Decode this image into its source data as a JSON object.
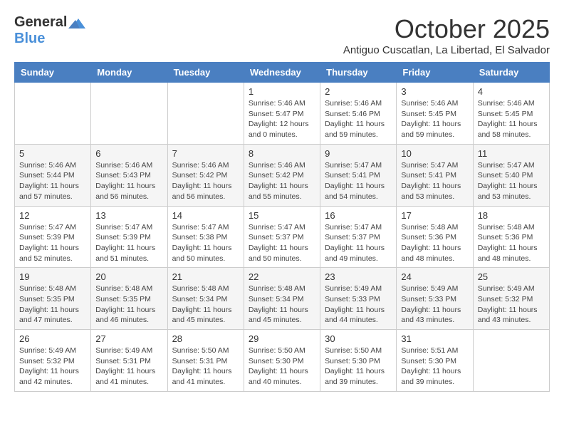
{
  "logo": {
    "general": "General",
    "blue": "Blue"
  },
  "title": "October 2025",
  "subtitle": "Antiguo Cuscatlan, La Libertad, El Salvador",
  "days_of_week": [
    "Sunday",
    "Monday",
    "Tuesday",
    "Wednesday",
    "Thursday",
    "Friday",
    "Saturday"
  ],
  "weeks": [
    [
      {
        "day": "",
        "info": ""
      },
      {
        "day": "",
        "info": ""
      },
      {
        "day": "",
        "info": ""
      },
      {
        "day": "1",
        "info": "Sunrise: 5:46 AM\nSunset: 5:47 PM\nDaylight: 12 hours\nand 0 minutes."
      },
      {
        "day": "2",
        "info": "Sunrise: 5:46 AM\nSunset: 5:46 PM\nDaylight: 11 hours\nand 59 minutes."
      },
      {
        "day": "3",
        "info": "Sunrise: 5:46 AM\nSunset: 5:45 PM\nDaylight: 11 hours\nand 59 minutes."
      },
      {
        "day": "4",
        "info": "Sunrise: 5:46 AM\nSunset: 5:45 PM\nDaylight: 11 hours\nand 58 minutes."
      }
    ],
    [
      {
        "day": "5",
        "info": "Sunrise: 5:46 AM\nSunset: 5:44 PM\nDaylight: 11 hours\nand 57 minutes."
      },
      {
        "day": "6",
        "info": "Sunrise: 5:46 AM\nSunset: 5:43 PM\nDaylight: 11 hours\nand 56 minutes."
      },
      {
        "day": "7",
        "info": "Sunrise: 5:46 AM\nSunset: 5:42 PM\nDaylight: 11 hours\nand 56 minutes."
      },
      {
        "day": "8",
        "info": "Sunrise: 5:46 AM\nSunset: 5:42 PM\nDaylight: 11 hours\nand 55 minutes."
      },
      {
        "day": "9",
        "info": "Sunrise: 5:47 AM\nSunset: 5:41 PM\nDaylight: 11 hours\nand 54 minutes."
      },
      {
        "day": "10",
        "info": "Sunrise: 5:47 AM\nSunset: 5:41 PM\nDaylight: 11 hours\nand 53 minutes."
      },
      {
        "day": "11",
        "info": "Sunrise: 5:47 AM\nSunset: 5:40 PM\nDaylight: 11 hours\nand 53 minutes."
      }
    ],
    [
      {
        "day": "12",
        "info": "Sunrise: 5:47 AM\nSunset: 5:39 PM\nDaylight: 11 hours\nand 52 minutes."
      },
      {
        "day": "13",
        "info": "Sunrise: 5:47 AM\nSunset: 5:39 PM\nDaylight: 11 hours\nand 51 minutes."
      },
      {
        "day": "14",
        "info": "Sunrise: 5:47 AM\nSunset: 5:38 PM\nDaylight: 11 hours\nand 50 minutes."
      },
      {
        "day": "15",
        "info": "Sunrise: 5:47 AM\nSunset: 5:37 PM\nDaylight: 11 hours\nand 50 minutes."
      },
      {
        "day": "16",
        "info": "Sunrise: 5:47 AM\nSunset: 5:37 PM\nDaylight: 11 hours\nand 49 minutes."
      },
      {
        "day": "17",
        "info": "Sunrise: 5:48 AM\nSunset: 5:36 PM\nDaylight: 11 hours\nand 48 minutes."
      },
      {
        "day": "18",
        "info": "Sunrise: 5:48 AM\nSunset: 5:36 PM\nDaylight: 11 hours\nand 48 minutes."
      }
    ],
    [
      {
        "day": "19",
        "info": "Sunrise: 5:48 AM\nSunset: 5:35 PM\nDaylight: 11 hours\nand 47 minutes."
      },
      {
        "day": "20",
        "info": "Sunrise: 5:48 AM\nSunset: 5:35 PM\nDaylight: 11 hours\nand 46 minutes."
      },
      {
        "day": "21",
        "info": "Sunrise: 5:48 AM\nSunset: 5:34 PM\nDaylight: 11 hours\nand 45 minutes."
      },
      {
        "day": "22",
        "info": "Sunrise: 5:48 AM\nSunset: 5:34 PM\nDaylight: 11 hours\nand 45 minutes."
      },
      {
        "day": "23",
        "info": "Sunrise: 5:49 AM\nSunset: 5:33 PM\nDaylight: 11 hours\nand 44 minutes."
      },
      {
        "day": "24",
        "info": "Sunrise: 5:49 AM\nSunset: 5:33 PM\nDaylight: 11 hours\nand 43 minutes."
      },
      {
        "day": "25",
        "info": "Sunrise: 5:49 AM\nSunset: 5:32 PM\nDaylight: 11 hours\nand 43 minutes."
      }
    ],
    [
      {
        "day": "26",
        "info": "Sunrise: 5:49 AM\nSunset: 5:32 PM\nDaylight: 11 hours\nand 42 minutes."
      },
      {
        "day": "27",
        "info": "Sunrise: 5:49 AM\nSunset: 5:31 PM\nDaylight: 11 hours\nand 41 minutes."
      },
      {
        "day": "28",
        "info": "Sunrise: 5:50 AM\nSunset: 5:31 PM\nDaylight: 11 hours\nand 41 minutes."
      },
      {
        "day": "29",
        "info": "Sunrise: 5:50 AM\nSunset: 5:30 PM\nDaylight: 11 hours\nand 40 minutes."
      },
      {
        "day": "30",
        "info": "Sunrise: 5:50 AM\nSunset: 5:30 PM\nDaylight: 11 hours\nand 39 minutes."
      },
      {
        "day": "31",
        "info": "Sunrise: 5:51 AM\nSunset: 5:30 PM\nDaylight: 11 hours\nand 39 minutes."
      },
      {
        "day": "",
        "info": ""
      }
    ]
  ]
}
